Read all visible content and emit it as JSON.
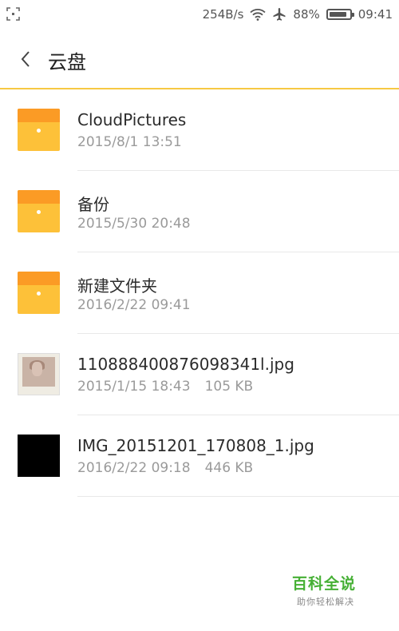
{
  "status_bar": {
    "network_speed": "254B/s",
    "battery_percent": "88%",
    "battery_level": 0.88,
    "time": "09:41"
  },
  "header": {
    "title": "云盘"
  },
  "files": [
    {
      "type": "folder",
      "name": "CloudPictures",
      "date": "2015/8/1 13:51",
      "size": ""
    },
    {
      "type": "folder",
      "name": "备份",
      "date": "2015/5/30 20:48",
      "size": ""
    },
    {
      "type": "folder",
      "name": "新建文件夹",
      "date": "2016/2/22 09:41",
      "size": ""
    },
    {
      "type": "image-photo",
      "name": "110888400876098341l.jpg",
      "date": "2015/1/15 18:43",
      "size": "105 KB"
    },
    {
      "type": "image-black",
      "name": "IMG_20151201_170808_1.jpg",
      "date": "2016/2/22 09:18",
      "size": "446 KB"
    }
  ],
  "watermark": {
    "main": "百科全说",
    "sub": "助你轻松解决"
  },
  "colors": {
    "folder_body": "#fdc139",
    "folder_flap": "#fb9b25",
    "header_accent": "#f7c843",
    "watermark_green": "#46b035"
  }
}
